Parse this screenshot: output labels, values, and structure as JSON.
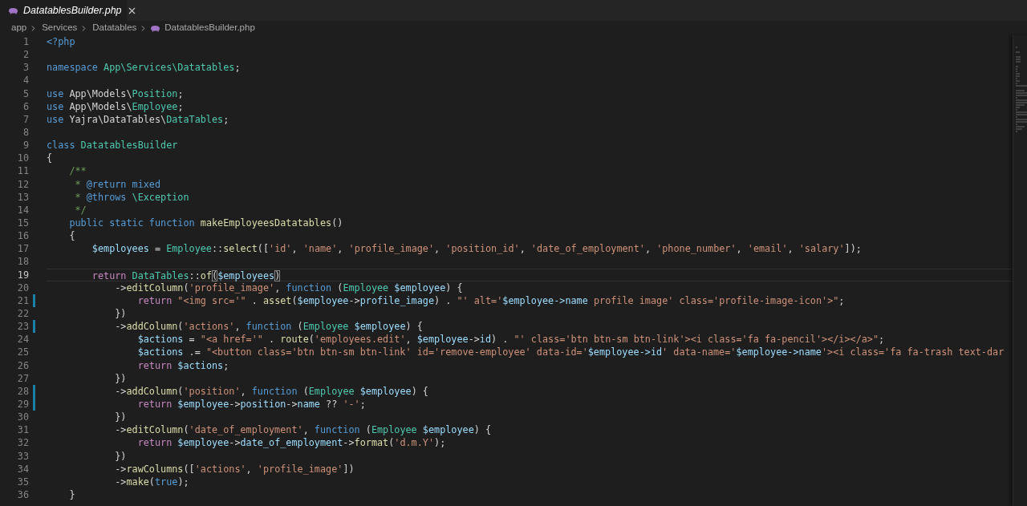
{
  "tab": {
    "label": "DatatablesBuilder.php",
    "preview": true
  },
  "breadcrumbs": [
    {
      "label": "app",
      "kind": "folder"
    },
    {
      "label": "Services",
      "kind": "folder"
    },
    {
      "label": "Datatables",
      "kind": "folder"
    },
    {
      "label": "DatatablesBuilder.php",
      "kind": "file"
    }
  ],
  "lines": [
    {
      "number": "1",
      "tokens": [
        {
          "kind": "kw",
          "text": "<?php"
        }
      ]
    },
    {
      "number": "2"
    },
    {
      "number": "3",
      "tokens": [
        {
          "kind": "kw",
          "text": "namespace"
        },
        {
          "kind": "type",
          "text": " App\\Services\\Datatables"
        },
        {
          "kind": "plain",
          "text": ";"
        }
      ]
    },
    {
      "number": "4"
    },
    {
      "number": "5",
      "tokens": [
        {
          "kind": "kw",
          "text": "use"
        },
        {
          "kind": "plain",
          "text": " App\\Models\\"
        },
        {
          "kind": "type",
          "text": "Position"
        },
        {
          "kind": "plain",
          "text": ";"
        }
      ]
    },
    {
      "number": "6",
      "tokens": [
        {
          "kind": "kw",
          "text": "use"
        },
        {
          "kind": "plain",
          "text": " App\\Models\\"
        },
        {
          "kind": "type",
          "text": "Employee"
        },
        {
          "kind": "plain",
          "text": ";"
        }
      ]
    },
    {
      "number": "7",
      "tokens": [
        {
          "kind": "kw",
          "text": "use"
        },
        {
          "kind": "plain",
          "text": " Yajra\\DataTables\\"
        },
        {
          "kind": "type",
          "text": "DataTables"
        },
        {
          "kind": "plain",
          "text": ";"
        }
      ]
    },
    {
      "number": "8"
    },
    {
      "number": "9",
      "tokens": [
        {
          "kind": "kw",
          "text": "class"
        },
        {
          "kind": "type",
          "text": " DatatablesBuilder"
        }
      ]
    },
    {
      "number": "10",
      "tokens": [
        {
          "kind": "plain",
          "text": "{"
        }
      ]
    },
    {
      "number": "11",
      "tokens": [
        {
          "kind": "cmt",
          "text": "    /**"
        }
      ]
    },
    {
      "number": "12",
      "tokens": [
        {
          "kind": "cmt",
          "text": "     *"
        },
        {
          "kind": "kw",
          "text": " @return"
        },
        {
          "kind": "kw",
          "text": " mixed"
        }
      ]
    },
    {
      "number": "13",
      "tokens": [
        {
          "kind": "cmt",
          "text": "     *"
        },
        {
          "kind": "kw",
          "text": " @throws"
        },
        {
          "kind": "type",
          "text": " \\Exception"
        }
      ]
    },
    {
      "number": "14",
      "tokens": [
        {
          "kind": "cmt",
          "text": "     */"
        }
      ]
    },
    {
      "number": "15",
      "tokens": [
        {
          "kind": "kw",
          "text": "    public static function"
        },
        {
          "kind": "fn",
          "text": " makeEmployeesDatatables"
        },
        {
          "kind": "plain",
          "text": "()"
        }
      ]
    },
    {
      "number": "16",
      "tokens": [
        {
          "kind": "plain",
          "text": "    {"
        }
      ]
    },
    {
      "number": "17",
      "tokens": [
        {
          "kind": "var",
          "text": "        $employees"
        },
        {
          "kind": "plain",
          "text": " = "
        },
        {
          "kind": "type",
          "text": "Employee"
        },
        {
          "kind": "plain",
          "text": "::"
        },
        {
          "kind": "fn",
          "text": "select"
        },
        {
          "kind": "plain",
          "text": "(["
        },
        {
          "kind": "str",
          "text": "'id'"
        },
        {
          "kind": "plain",
          "text": ", "
        },
        {
          "kind": "str",
          "text": "'name'"
        },
        {
          "kind": "plain",
          "text": ", "
        },
        {
          "kind": "str",
          "text": "'profile_image'"
        },
        {
          "kind": "plain",
          "text": ", "
        },
        {
          "kind": "str",
          "text": "'position_id'"
        },
        {
          "kind": "plain",
          "text": ", "
        },
        {
          "kind": "str",
          "text": "'date_of_employment'"
        },
        {
          "kind": "plain",
          "text": ", "
        },
        {
          "kind": "str",
          "text": "'phone_number'"
        },
        {
          "kind": "plain",
          "text": ", "
        },
        {
          "kind": "str",
          "text": "'email'"
        },
        {
          "kind": "plain",
          "text": ", "
        },
        {
          "kind": "str",
          "text": "'salary'"
        },
        {
          "kind": "plain",
          "text": "]);"
        }
      ]
    },
    {
      "number": "18"
    },
    {
      "number": "19",
      "current": true,
      "tokens": [
        {
          "kind": "ctl",
          "text": "        return"
        },
        {
          "kind": "type",
          "text": " DataTables"
        },
        {
          "kind": "plain",
          "text": "::"
        },
        {
          "kind": "fn",
          "text": "of"
        },
        {
          "kind": "bracket",
          "text": "("
        },
        {
          "kind": "var",
          "text": "$employees"
        },
        {
          "kind": "bracket",
          "text": ")"
        }
      ]
    },
    {
      "number": "20",
      "tokens": [
        {
          "kind": "plain",
          "text": "            ->"
        },
        {
          "kind": "fn",
          "text": "editColumn"
        },
        {
          "kind": "plain",
          "text": "("
        },
        {
          "kind": "str",
          "text": "'profile_image'"
        },
        {
          "kind": "plain",
          "text": ", "
        },
        {
          "kind": "kw",
          "text": "function"
        },
        {
          "kind": "plain",
          "text": " ("
        },
        {
          "kind": "type",
          "text": "Employee"
        },
        {
          "kind": "var",
          "text": " $employee"
        },
        {
          "kind": "plain",
          "text": ") {"
        }
      ]
    },
    {
      "number": "21",
      "modified": true,
      "tokens": [
        {
          "kind": "ctl",
          "text": "                return"
        },
        {
          "kind": "str",
          "text": " \"<img src='\""
        },
        {
          "kind": "plain",
          "text": " . "
        },
        {
          "kind": "fn",
          "text": "asset"
        },
        {
          "kind": "plain",
          "text": "("
        },
        {
          "kind": "var",
          "text": "$employee"
        },
        {
          "kind": "plain",
          "text": "->"
        },
        {
          "kind": "var",
          "text": "profile_image"
        },
        {
          "kind": "plain",
          "text": ") . "
        },
        {
          "kind": "str",
          "text": "\"' alt='"
        },
        {
          "kind": "var",
          "text": "$employee->name"
        },
        {
          "kind": "str",
          "text": " profile image' class='profile-image-icon'>\""
        },
        {
          "kind": "plain",
          "text": ";"
        }
      ]
    },
    {
      "number": "22",
      "tokens": [
        {
          "kind": "plain",
          "text": "            })"
        }
      ]
    },
    {
      "number": "23",
      "modified": true,
      "tokens": [
        {
          "kind": "plain",
          "text": "            ->"
        },
        {
          "kind": "fn",
          "text": "addColumn"
        },
        {
          "kind": "plain",
          "text": "("
        },
        {
          "kind": "str",
          "text": "'actions'"
        },
        {
          "kind": "plain",
          "text": ", "
        },
        {
          "kind": "kw",
          "text": "function"
        },
        {
          "kind": "plain",
          "text": " ("
        },
        {
          "kind": "type",
          "text": "Employee"
        },
        {
          "kind": "var",
          "text": " $employee"
        },
        {
          "kind": "plain",
          "text": ") {"
        }
      ]
    },
    {
      "number": "24",
      "tokens": [
        {
          "kind": "var",
          "text": "                $actions"
        },
        {
          "kind": "plain",
          "text": " = "
        },
        {
          "kind": "str",
          "text": "\"<a href='\""
        },
        {
          "kind": "plain",
          "text": " . "
        },
        {
          "kind": "fn",
          "text": "route"
        },
        {
          "kind": "plain",
          "text": "("
        },
        {
          "kind": "str",
          "text": "'employees.edit'"
        },
        {
          "kind": "plain",
          "text": ", "
        },
        {
          "kind": "var",
          "text": "$employee"
        },
        {
          "kind": "plain",
          "text": "->"
        },
        {
          "kind": "var",
          "text": "id"
        },
        {
          "kind": "plain",
          "text": ") . "
        },
        {
          "kind": "str",
          "text": "\"' class='btn btn-sm btn-link'><i class='fa fa-pencil'></i></a>\""
        },
        {
          "kind": "plain",
          "text": ";"
        }
      ]
    },
    {
      "number": "25",
      "tokens": [
        {
          "kind": "var",
          "text": "                $actions"
        },
        {
          "kind": "plain",
          "text": " .= "
        },
        {
          "kind": "str",
          "text": "\"<button class='btn btn-sm btn-link' id='remove-employee' data-id='"
        },
        {
          "kind": "var",
          "text": "$employee->id"
        },
        {
          "kind": "str",
          "text": "' data-name='"
        },
        {
          "kind": "var",
          "text": "$employee->name"
        },
        {
          "kind": "str",
          "text": "'><i class='fa fa-trash text-dar"
        }
      ]
    },
    {
      "number": "26",
      "tokens": [
        {
          "kind": "ctl",
          "text": "                return"
        },
        {
          "kind": "var",
          "text": " $actions"
        },
        {
          "kind": "plain",
          "text": ";"
        }
      ]
    },
    {
      "number": "27",
      "tokens": [
        {
          "kind": "plain",
          "text": "            })"
        }
      ]
    },
    {
      "number": "28",
      "modified": true,
      "tokens": [
        {
          "kind": "plain",
          "text": "            ->"
        },
        {
          "kind": "fn",
          "text": "addColumn"
        },
        {
          "kind": "plain",
          "text": "("
        },
        {
          "kind": "str",
          "text": "'position'"
        },
        {
          "kind": "plain",
          "text": ", "
        },
        {
          "kind": "kw",
          "text": "function"
        },
        {
          "kind": "plain",
          "text": " ("
        },
        {
          "kind": "type",
          "text": "Employee"
        },
        {
          "kind": "var",
          "text": " $employee"
        },
        {
          "kind": "plain",
          "text": ") {"
        }
      ]
    },
    {
      "number": "29",
      "modified": true,
      "tokens": [
        {
          "kind": "ctl",
          "text": "                return"
        },
        {
          "kind": "var",
          "text": " $employee"
        },
        {
          "kind": "plain",
          "text": "->"
        },
        {
          "kind": "var",
          "text": "position"
        },
        {
          "kind": "plain",
          "text": "->"
        },
        {
          "kind": "var",
          "text": "name"
        },
        {
          "kind": "plain",
          "text": " ?? "
        },
        {
          "kind": "str",
          "text": "'-'"
        },
        {
          "kind": "plain",
          "text": ";"
        }
      ]
    },
    {
      "number": "30",
      "tokens": [
        {
          "kind": "plain",
          "text": "            })"
        }
      ]
    },
    {
      "number": "31",
      "tokens": [
        {
          "kind": "plain",
          "text": "            ->"
        },
        {
          "kind": "fn",
          "text": "editColumn"
        },
        {
          "kind": "plain",
          "text": "("
        },
        {
          "kind": "str",
          "text": "'date_of_employment'"
        },
        {
          "kind": "plain",
          "text": ", "
        },
        {
          "kind": "kw",
          "text": "function"
        },
        {
          "kind": "plain",
          "text": " ("
        },
        {
          "kind": "type",
          "text": "Employee"
        },
        {
          "kind": "var",
          "text": " $employee"
        },
        {
          "kind": "plain",
          "text": ") {"
        }
      ]
    },
    {
      "number": "32",
      "tokens": [
        {
          "kind": "ctl",
          "text": "                return"
        },
        {
          "kind": "var",
          "text": " $employee"
        },
        {
          "kind": "plain",
          "text": "->"
        },
        {
          "kind": "var",
          "text": "date_of_employment"
        },
        {
          "kind": "plain",
          "text": "->"
        },
        {
          "kind": "fn",
          "text": "format"
        },
        {
          "kind": "plain",
          "text": "("
        },
        {
          "kind": "str",
          "text": "'d.m.Y'"
        },
        {
          "kind": "plain",
          "text": ");"
        }
      ]
    },
    {
      "number": "33",
      "tokens": [
        {
          "kind": "plain",
          "text": "            })"
        }
      ]
    },
    {
      "number": "34",
      "tokens": [
        {
          "kind": "plain",
          "text": "            ->"
        },
        {
          "kind": "fn",
          "text": "rawColumns"
        },
        {
          "kind": "plain",
          "text": "(["
        },
        {
          "kind": "str",
          "text": "'actions'"
        },
        {
          "kind": "plain",
          "text": ", "
        },
        {
          "kind": "str",
          "text": "'profile_image'"
        },
        {
          "kind": "plain",
          "text": "])"
        }
      ]
    },
    {
      "number": "35",
      "tokens": [
        {
          "kind": "plain",
          "text": "            ->"
        },
        {
          "kind": "fn",
          "text": "make"
        },
        {
          "kind": "plain",
          "text": "("
        },
        {
          "kind": "kw",
          "text": "true"
        },
        {
          "kind": "plain",
          "text": ");"
        }
      ]
    },
    {
      "number": "36",
      "tokens": [
        {
          "kind": "plain",
          "text": "    }"
        }
      ]
    }
  ]
}
